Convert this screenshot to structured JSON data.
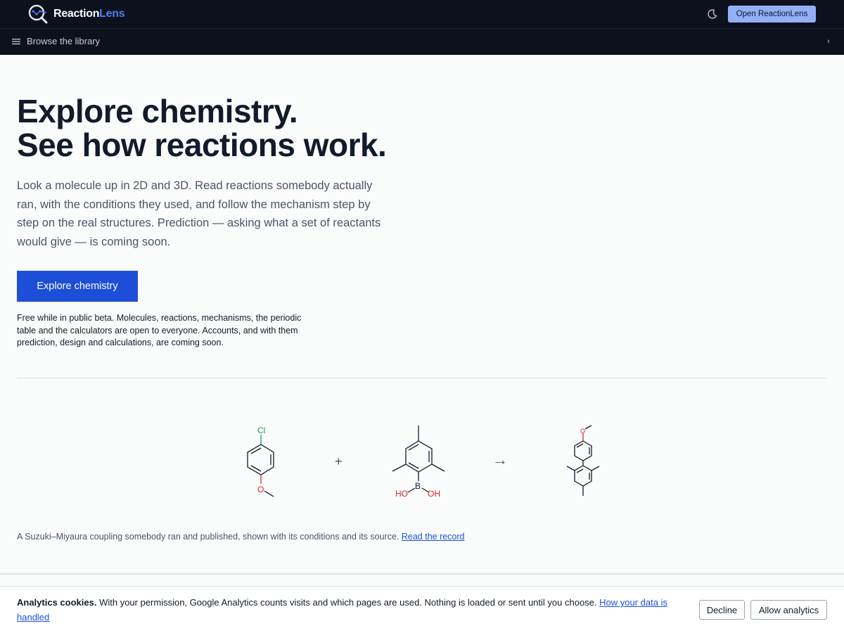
{
  "header": {
    "brand_part1": "Reaction",
    "brand_part2": "Lens",
    "open_button": "Open ReactionLens"
  },
  "subnav": {
    "browse_label": "Browse the library"
  },
  "hero": {
    "title_line1": "Explore chemistry.",
    "title_line2": "See how reactions work.",
    "lede": "Look a molecule up in 2D and 3D. Read reactions somebody actually ran, with the conditions they used, and follow the mechanism step by step on the real structures. Prediction — asking what a set of reactants would give — is coming soon.",
    "cta": "Explore chemistry",
    "note": "Free while in public beta. Molecules, reactions, mechanisms, the periodic table and the calculators are open to everyone. Accounts, and with them prediction, design and calculations, are coming soon."
  },
  "reaction": {
    "plus": "+",
    "arrow": "→",
    "atoms": {
      "chlorine": "Cl",
      "oxygen": "O",
      "boron": "B",
      "hydroxyl_left": "HO",
      "hydroxyl_right": "OH",
      "product_oxygen": "O"
    },
    "caption": "A Suzuki–Miyaura coupling somebody ran and published, shown with its conditions and its source.",
    "link": "Read the record"
  },
  "cookies": {
    "title": "Analytics cookies.",
    "body": "With your permission, Google Analytics counts visits and which pages are used. Nothing is loaded or sent until you choose.",
    "link": "How your data is handled",
    "decline": "Decline",
    "allow": "Allow analytics"
  },
  "colors": {
    "nav_bg": "#0c111d",
    "accent": "#1c4ed8",
    "open_button_bg": "#93b0f6",
    "chlorine": "#16a34a",
    "oxygen": "#dc2626"
  }
}
